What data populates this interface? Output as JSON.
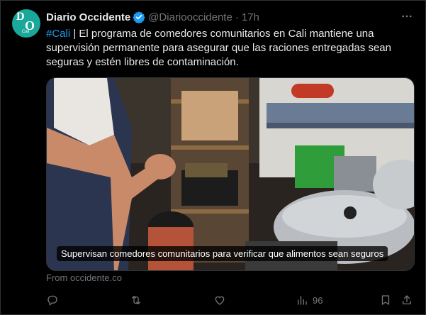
{
  "tweet": {
    "author_name": "Diario Occidente",
    "avatar_letters": [
      "D",
      "O",
      "Cali"
    ],
    "handle": "@Diariooccidente",
    "separator": "·",
    "time": "17h",
    "hashtag": "#Cali",
    "body": " | El programa de comedores comunitarios en Cali mantiene una supervisión permanente para asegurar que las raciones entregadas sean seguras y estén libres de contaminación.",
    "media_caption": "Supervisan comedores comunitarios para verificar que alimentos sean seguros",
    "source": "From occidente.co",
    "views": "96"
  },
  "colors": {
    "accent": "#1d9bf0",
    "muted": "#71767b",
    "text": "#e7e9ea",
    "background": "#000000"
  },
  "icons": [
    "verified-badge-icon",
    "more-icon",
    "reply-icon",
    "retweet-icon",
    "like-icon",
    "views-icon",
    "bookmark-icon",
    "share-icon"
  ]
}
